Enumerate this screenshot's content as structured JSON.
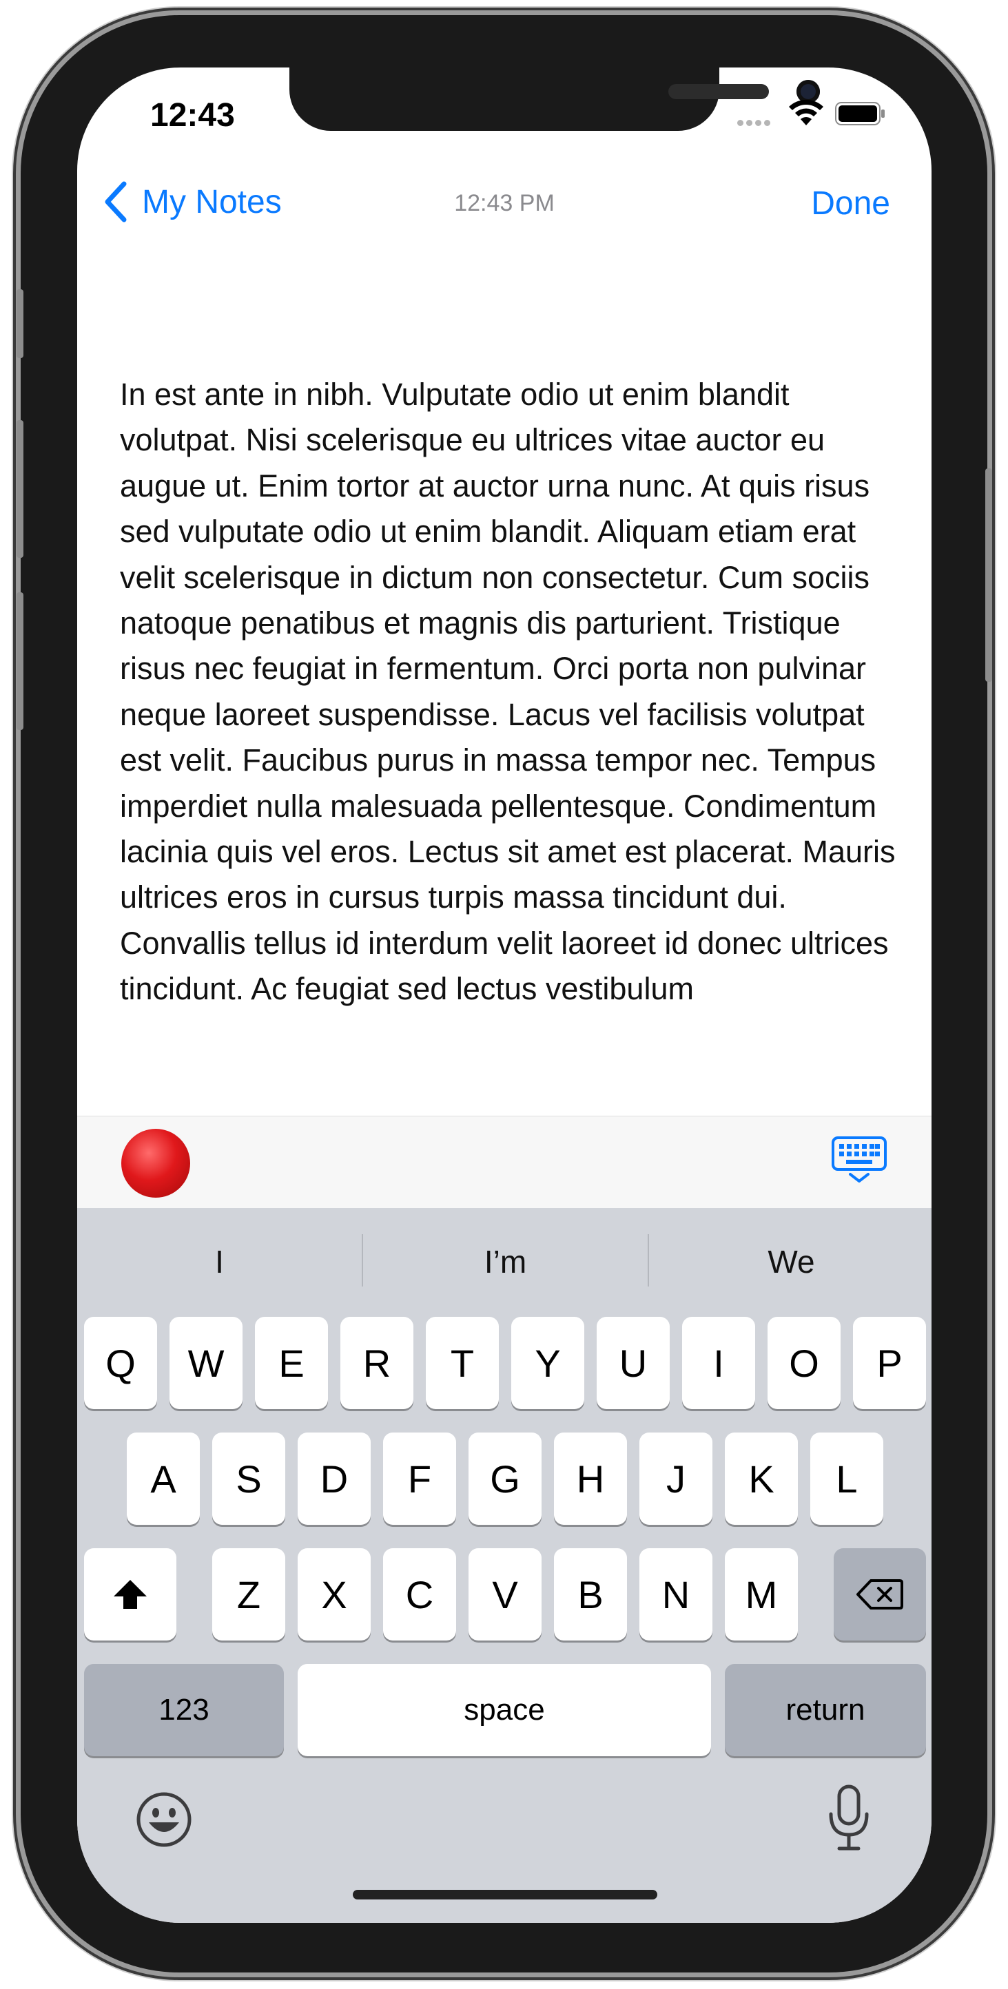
{
  "status_bar": {
    "time": "12:43"
  },
  "nav": {
    "back_label": "My Notes",
    "timestamp": "12:43 PM",
    "done_label": "Done"
  },
  "note": {
    "text": "In est ante in nibh. Vulputate odio ut enim blandit volutpat. Nisi scelerisque eu ultrices vitae auctor eu augue ut. Enim tortor at auctor urna nunc. At quis risus sed vulputate odio ut enim blandit. Aliquam etiam erat velit scelerisque in dictum non consectetur. Cum sociis natoque penatibus et magnis dis parturient. Tristique risus nec feugiat in fermentum. Orci porta non pulvinar neque laoreet suspendisse. Lacus vel facilisis volutpat est velit. Faucibus purus in massa tempor nec. Tempus imperdiet nulla malesuada pellentesque. Condimentum lacinia quis vel eros. Lectus sit amet est placerat. Mauris ultrices eros in cursus turpis massa tincidunt dui. Convallis tellus id interdum velit laoreet id donec ultrices tincidunt. Ac feugiat sed lectus vestibulum"
  },
  "toolbar": {
    "record_icon": "record-icon",
    "keyboard_icon": "keyboard-dismiss-icon",
    "accent": "#0a7aff",
    "record_color": "#e0181b"
  },
  "keyboard": {
    "suggestions": [
      "I",
      "I’m",
      "We"
    ],
    "row1": [
      "Q",
      "W",
      "E",
      "R",
      "T",
      "Y",
      "U",
      "I",
      "O",
      "P"
    ],
    "row2": [
      "A",
      "S",
      "D",
      "F",
      "G",
      "H",
      "J",
      "K",
      "L"
    ],
    "row3": [
      "Z",
      "X",
      "C",
      "V",
      "B",
      "N",
      "M"
    ],
    "numbers_label": "123",
    "space_label": "space",
    "return_label": "return",
    "shift_icon": "shift-icon",
    "delete_icon": "delete-icon",
    "emoji_icon": "emoji-icon",
    "mic_icon": "microphone-icon"
  }
}
